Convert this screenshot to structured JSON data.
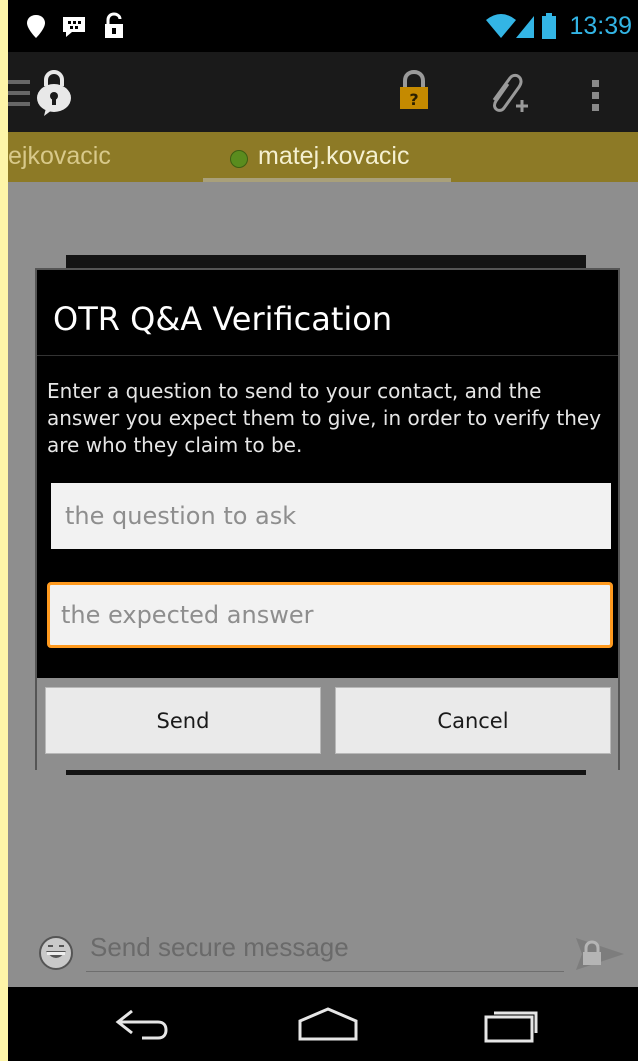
{
  "status_bar": {
    "time": "13:39",
    "left_icons": [
      "location-icon",
      "bbm-icon",
      "unlock-icon"
    ],
    "right_icons": [
      "wifi-icon",
      "signal-icon",
      "battery-icon"
    ]
  },
  "action_bar": {
    "icons": [
      "menu-icon",
      "app-lock-icon",
      "unverified-lock-icon",
      "attach-icon",
      "overflow-menu-icon"
    ]
  },
  "tabs": {
    "left_label": "ejkovacic",
    "active_label": "matej.kovacic",
    "status_color": "#5a8c1e"
  },
  "dialog": {
    "title": "OTR Q&A Verification",
    "message": "Enter a question to send to your contact, and the answer you expect them to give, in order to verify they are who they claim to be.",
    "question_placeholder": "the question to ask",
    "answer_placeholder": "the expected answer",
    "send_label": "Send",
    "cancel_label": "Cancel",
    "focus_color": "#ff9a1f"
  },
  "composer": {
    "placeholder": "Send secure message",
    "icons": [
      "emoji-icon",
      "send-secure-icon"
    ]
  },
  "nav_bar": {
    "icons": [
      "back-icon",
      "home-icon",
      "recents-icon"
    ]
  },
  "colors": {
    "accent": "#33b5e5",
    "tab_bar": "#8d7a26",
    "page_background": "#fdf5a8"
  }
}
